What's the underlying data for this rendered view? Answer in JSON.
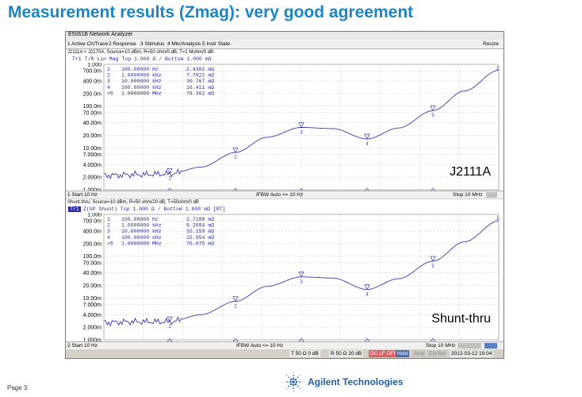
{
  "slide": {
    "title": "Measurement results (Zmag): very good agreement",
    "page_label": "Page 3",
    "company": "Agilent Technologies"
  },
  "window": {
    "title": "E5061B Network Analyzer",
    "menu": [
      "1 Active Ch/Trace",
      "2 Response",
      "3 Stimulus",
      "4 Mkr/Analysis",
      "5 Instr State"
    ],
    "resize_label": "Resize"
  },
  "channels": [
    {
      "header": "J2111A + J2170A, Source=10 dBm, R=50 ohm/0 dB, T=1 Mohm/0 dB",
      "trace_tag": "",
      "trace_label": "Tr1 T/R Lin Mag Top 1.000 Ω / Bottom 1.000 mΩ",
      "ytick_labels": [
        "1.000",
        "700.0m",
        "400.0m",
        "200.0m",
        "100.0m",
        "70.00m",
        "40.00m",
        "20.00m",
        "10.00m",
        "7.000m",
        "4.000m",
        "2.000m",
        "1.000m"
      ],
      "markers": [
        {
          "num": "1",
          "freq": "100.00000 Hz",
          "val": "2.4382 mΩ"
        },
        {
          "num": "2",
          "freq": "1.0000000 kHz",
          "val": "7.7622 mΩ"
        },
        {
          "num": "3",
          "freq": "10.000000 kHz",
          "val": "30.767 mΩ"
        },
        {
          "num": "4",
          "freq": "100.00000 kHz",
          "val": "16.411 mΩ"
        },
        {
          "num": ">5",
          "freq": "1.0000000 MHz",
          "val": "78.362 mΩ"
        }
      ],
      "annotation": "J2111A",
      "status_left": "1  Start 10 Hz",
      "status_mid": "IFBW Auto <= 10 Hz",
      "status_right": "Stop 10 MHz"
    },
    {
      "header": "Shunt-thru, Source=10 dBm, R=50 ohm/20 dB, T=50ohm/0 dB",
      "trace_tag": "Tr1",
      "trace_label": "Z(GP Shunt)   Top 1.000 Ω / Bottom 1.000 mΩ [RT]",
      "ytick_labels": [
        "1.000",
        "700.0m",
        "400.0m",
        "200.0m",
        "100.0m",
        "70.00m",
        "40.00m",
        "20.00m",
        "10.00m",
        "7.000m",
        "4.000m",
        "2.000m",
        "1.000m"
      ],
      "markers": [
        {
          "num": "1",
          "freq": "100.00000 Hz",
          "val": "2.7188 mΩ"
        },
        {
          "num": "2",
          "freq": "1.0000000 kHz",
          "val": "8.2694 mΩ"
        },
        {
          "num": "3",
          "freq": "10.000000 kHz",
          "val": "32.159 mΩ"
        },
        {
          "num": "4",
          "freq": "100.00000 kHz",
          "val": "15.954 mΩ"
        },
        {
          "num": ">5",
          "freq": "1.0000000 MHz",
          "val": "76.075 mΩ"
        }
      ],
      "annotation": "Shunt-thru",
      "status_left": "2  Start 10 Hz",
      "status_mid": "IFBW Auto <= 10 Hz",
      "status_right": "Stop 10 MHz"
    }
  ],
  "bottombar": {
    "t_label": "T 50 Ω 0 dB",
    "r_label": "R 50 Ω 20 dB",
    "dclf": "DC LF OFF",
    "hold": "Hold",
    "extref": "Ext Ref",
    "datetime": "2012-03-12 19:04"
  },
  "chart_data": [
    {
      "type": "line",
      "title": "Tr1 T/R Lin Mag",
      "xlabel": "",
      "ylabel": "",
      "x_scale": "log",
      "xlim_hz": [
        10,
        10000000
      ],
      "y_scale": "log",
      "ylim_ohm": [
        0.001,
        1.0
      ],
      "series": [
        {
          "name": "",
          "x_hz": [
            10,
            30,
            100,
            300,
            1000,
            3000,
            10000,
            30000,
            100000,
            300000,
            1000000,
            3000000,
            10000000
          ],
          "y_ohm": [
            0.0022,
            0.0023,
            0.0024,
            0.0035,
            0.0078,
            0.018,
            0.031,
            0.029,
            0.0164,
            0.03,
            0.078,
            0.23,
            0.72
          ]
        }
      ],
      "markers_hz": [
        100,
        1000,
        10000,
        100000,
        1000000
      ],
      "markers_ohm": [
        0.0024382,
        0.0077622,
        0.030767,
        0.016411,
        0.078362
      ]
    },
    {
      "type": "line",
      "title": "Z(GP Shunt)",
      "xlabel": "",
      "ylabel": "",
      "x_scale": "log",
      "xlim_hz": [
        10,
        10000000
      ],
      "y_scale": "log",
      "ylim_ohm": [
        0.001,
        1.0
      ],
      "series": [
        {
          "name": "",
          "x_hz": [
            10,
            30,
            100,
            300,
            1000,
            3000,
            10000,
            30000,
            100000,
            300000,
            1000000,
            3000000,
            10000000
          ],
          "y_ohm": [
            0.0026,
            0.0027,
            0.0027,
            0.004,
            0.0083,
            0.019,
            0.032,
            0.03,
            0.016,
            0.029,
            0.076,
            0.22,
            0.7
          ]
        }
      ],
      "markers_hz": [
        100,
        1000,
        10000,
        100000,
        1000000
      ],
      "markers_ohm": [
        0.0027188,
        0.0082694,
        0.032159,
        0.015954,
        0.076075
      ]
    }
  ]
}
